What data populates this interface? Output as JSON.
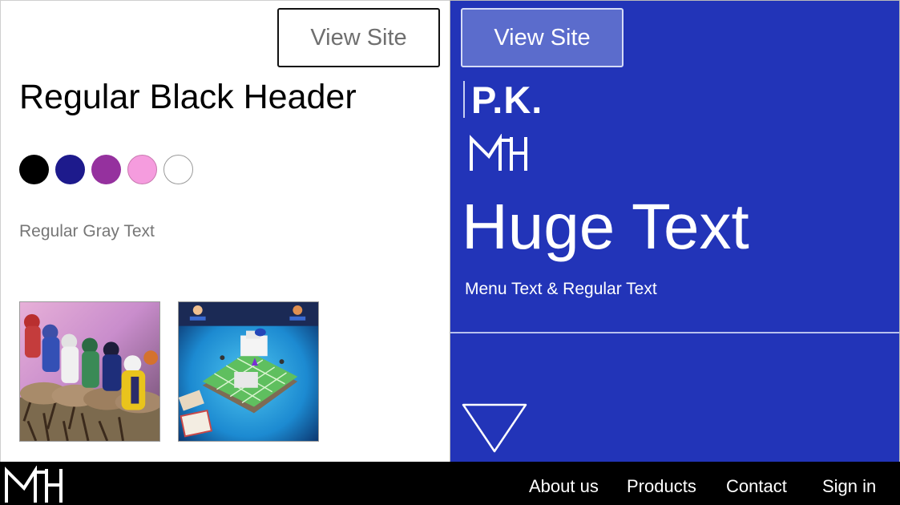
{
  "left": {
    "view_site_label": "View Site",
    "header": "Regular Black Header",
    "swatches": [
      {
        "color": "#000000"
      },
      {
        "color": "#1d1a8c"
      },
      {
        "color": "#95319e"
      },
      {
        "color": "#f59cde"
      },
      {
        "color": "#ffffff"
      }
    ],
    "gray_text": "Regular Gray Text"
  },
  "right": {
    "view_site_label": "View Site",
    "brand_text": "P.K.",
    "huge_text": "Huge Text",
    "menu_text": "Menu Text & Regular Text",
    "background_color": "#2234b8"
  },
  "footer": {
    "nav": [
      {
        "label": "About us"
      },
      {
        "label": "Products"
      },
      {
        "label": "Contact"
      },
      {
        "label": "Sign in"
      }
    ]
  }
}
